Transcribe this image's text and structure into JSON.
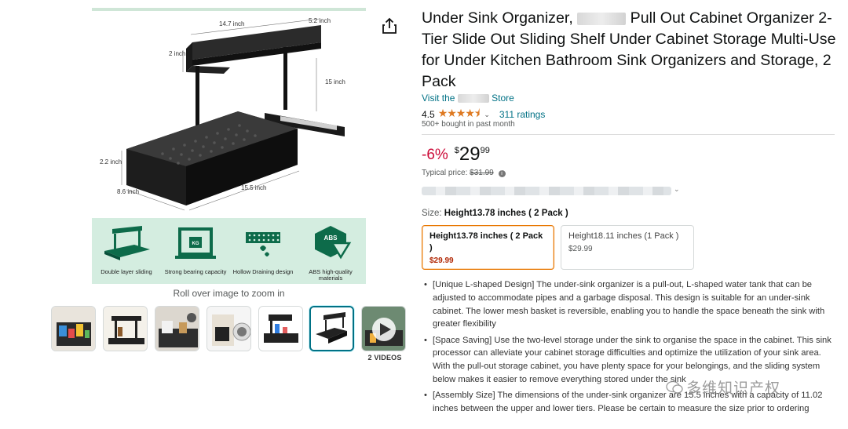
{
  "product": {
    "title_part1": "Under Sink Organizer,",
    "title_part2": "Pull Out Cabinet Organizer 2-Tier Slide Out Sliding Shelf Under Cabinet Storage Multi-Use for Under Kitchen Bathroom Sink Organizers and Storage, 2 Pack",
    "store_prefix": "Visit the",
    "store_suffix": "Store",
    "rating_value": "4.5",
    "stars": "★★★★⯨",
    "rating_count": "311 ratings",
    "bought": "500+ bought in past month"
  },
  "price": {
    "discount": "-6%",
    "currency": "$",
    "whole": "29",
    "fraction": "99",
    "typical_label": "Typical price:",
    "typical_value": "$31.99"
  },
  "size": {
    "label": "Size:",
    "selected": "Height13.78 inches ( 2 Pack )",
    "options": [
      {
        "name": "Height13.78 inches ( 2 Pack )",
        "price": "$29.99"
      },
      {
        "name": "Height18.11 inches (1 Pack )",
        "price": "$29.99"
      }
    ]
  },
  "image": {
    "dimensions": {
      "width": "14.7 inch",
      "depth": "5.2 inch",
      "top_height": "2 inch",
      "upright": "15 inch",
      "bottom_height": "2.2 inch",
      "bottom_depth": "8.6 inch",
      "length": "15.5 inch"
    },
    "features": [
      "Double layer sliding",
      "Strong bearing capacity",
      "Hollow Draining design",
      "ABS high-quality materials"
    ],
    "badge_kg": "KG",
    "badge_abs": "ABS",
    "zoom_hint": "Roll over image to zoom in",
    "videos_label": "2 VIDEOS"
  },
  "bullets": [
    "[Unique L-shaped Design] The under-sink organizer is a pull-out, L-shaped water tank that can be adjusted to accommodate pipes and a garbage disposal. This design is suitable for an under-sink cabinet. The lower mesh basket is reversible, enabling you to handle the space beneath the sink with greater flexibility",
    "[Space Saving] Use the two-level storage under the sink to organise the space in the cabinet. This sink processor can alleviate your cabinet storage difficulties and optimize the utilization of your sink area. With the pull-out storage cabinet, you have plenty space for your belongings, and the sliding system below makes it easier to remove everything stored under the sink",
    "[Assembly Size] The dimensions of the under-sink organizer are 15.5 inches with a capacity of 11.02 inches between the upper and lower tiers. Please be certain to measure the size prior to ordering"
  ],
  "watermark": "多维知识产权",
  "colors": {
    "link": "#007185",
    "discount": "#cc0c39",
    "star": "#de7921",
    "selected_border": "#e77600",
    "feature_band": "#d4ede0"
  }
}
